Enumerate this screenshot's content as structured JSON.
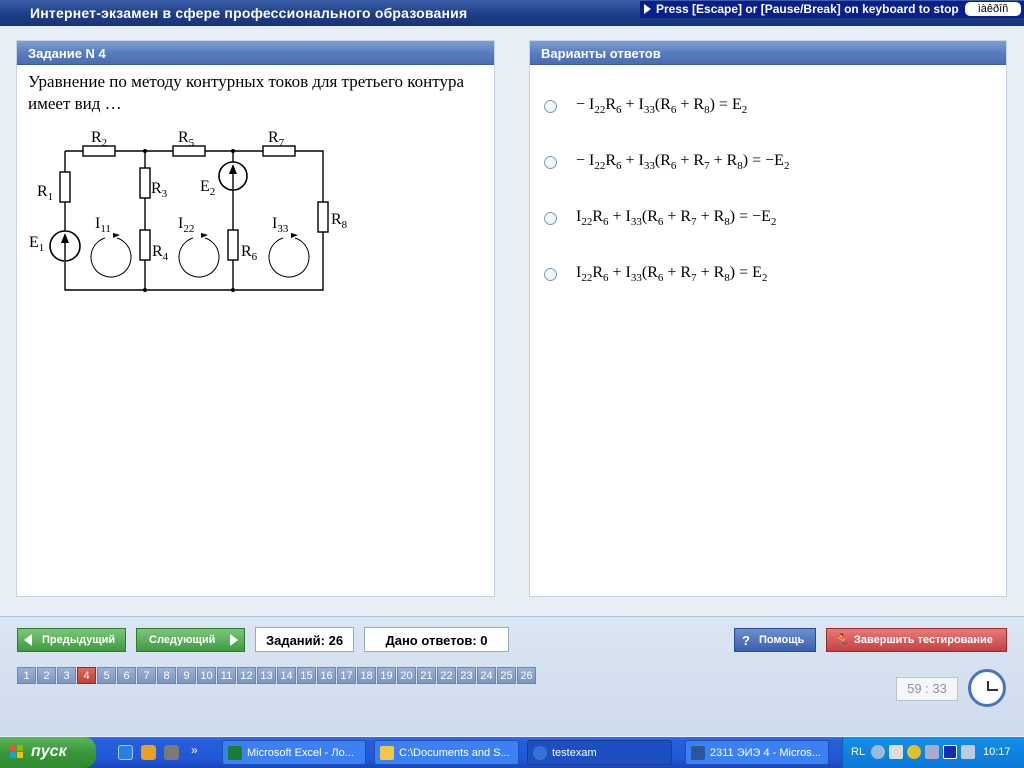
{
  "window": {
    "title": "Интернет-экзамен в сфере профессионального образования",
    "escape_hint": "Press [Escape] or [Pause/Break] on keyboard to stop",
    "lang_indicator": "ìàêðîñ"
  },
  "task": {
    "header": "Задание N 4",
    "question": "Уравнение по методу контурных токов для третьего контура имеет вид …",
    "circuit_labels": {
      "R1": "R1",
      "R2": "R2",
      "R3": "R3",
      "R4": "R4",
      "R5": "R5",
      "R6": "R6",
      "R7": "R7",
      "R8": "R8",
      "E1": "E1",
      "E2": "E2",
      "I11": "I11",
      "I22": "I22",
      "I33": "I33"
    }
  },
  "answers": {
    "header": "Варианты ответов",
    "options": [
      "− I22R6 + I33(R6 + R8) = E2",
      "− I22R6 + I33(R6 + R7 + R8) = −E2",
      "I22R6 + I33(R6 + R7 + R8) = −E2",
      "I22R6 + I33(R6 + R7 + R8) = E2"
    ]
  },
  "nav": {
    "prev_label": "Предыдущий",
    "next_label": "Следующий",
    "tasks_count": "Заданий: 26",
    "answers_given": "Дано ответов: 0",
    "help_label": "Помощь",
    "finish_label": "Завершить тестирование",
    "pages": [
      "1",
      "2",
      "3",
      "4",
      "5",
      "6",
      "7",
      "8",
      "9",
      "10",
      "11",
      "12",
      "13",
      "14",
      "15",
      "16",
      "17",
      "18",
      "19",
      "20",
      "21",
      "22",
      "23",
      "24",
      "25",
      "26"
    ],
    "current_page": "4",
    "timer": "59 : 33"
  },
  "taskbar": {
    "start_label": "пуск",
    "overflow": "»",
    "tasks": [
      {
        "label": "Microsoft Excel - Ло...",
        "icon": "excel-icon",
        "active": false
      },
      {
        "label": "C:\\Documents and S...",
        "icon": "folder-icon",
        "active": false
      },
      {
        "label": "testexam",
        "icon": "app-icon",
        "active": true
      },
      {
        "label": "2311 ЭИЭ 4 - Micros...",
        "icon": "word-icon",
        "active": false
      }
    ],
    "lang": "RL",
    "time": "10:17"
  },
  "colors": {
    "panel_header": "#5a7dbf",
    "nav_green": "#3f9a3f",
    "finish_red": "#c94040",
    "active_page": "#c0402f"
  }
}
